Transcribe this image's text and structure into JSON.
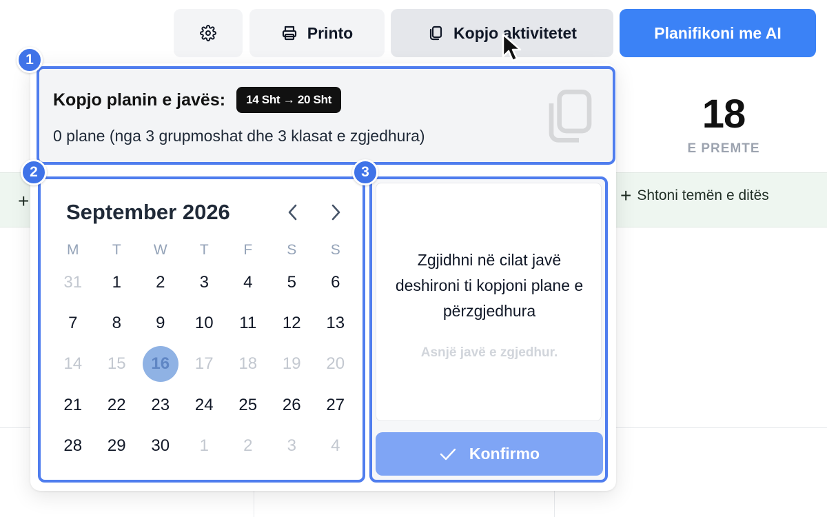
{
  "toolbar": {
    "settings_icon": "gear-icon",
    "print_label": "Printo",
    "print_icon": "printer-icon",
    "copy_label": "Kopjo aktivitetet",
    "copy_icon": "copy-icon",
    "ai_label": "Planifikoni me AI"
  },
  "calendar_bg": {
    "day_number": "18",
    "day_name": "E PREMTE",
    "add_theme_label": "Shtoni temën e ditës"
  },
  "badges": [
    "1",
    "2",
    "3"
  ],
  "copy_panel": {
    "title": "Kopjo planin e javës:",
    "week_range": "14 Sht → 20 Sht",
    "summary": "0 plane (nga 3 grupmoshat dhe 3 klasat e zgjedhura)"
  },
  "date_picker": {
    "month_label": "September 2026",
    "weekdays": [
      "M",
      "T",
      "W",
      "T",
      "F",
      "S",
      "S"
    ],
    "weeks": [
      [
        {
          "d": "31",
          "m": true
        },
        {
          "d": "1"
        },
        {
          "d": "2"
        },
        {
          "d": "3"
        },
        {
          "d": "4"
        },
        {
          "d": "5"
        },
        {
          "d": "6"
        }
      ],
      [
        {
          "d": "7"
        },
        {
          "d": "8"
        },
        {
          "d": "9"
        },
        {
          "d": "10"
        },
        {
          "d": "11"
        },
        {
          "d": "12"
        },
        {
          "d": "13"
        }
      ],
      [
        {
          "d": "14",
          "m": true
        },
        {
          "d": "15",
          "m": true
        },
        {
          "d": "16",
          "m": true,
          "s": true
        },
        {
          "d": "17",
          "m": true
        },
        {
          "d": "18",
          "m": true
        },
        {
          "d": "19",
          "m": true
        },
        {
          "d": "20",
          "m": true
        }
      ],
      [
        {
          "d": "21"
        },
        {
          "d": "22"
        },
        {
          "d": "23"
        },
        {
          "d": "24"
        },
        {
          "d": "25"
        },
        {
          "d": "26"
        },
        {
          "d": "27"
        }
      ],
      [
        {
          "d": "28"
        },
        {
          "d": "29"
        },
        {
          "d": "30"
        },
        {
          "d": "1",
          "m": true
        },
        {
          "d": "2",
          "m": true
        },
        {
          "d": "3",
          "m": true
        },
        {
          "d": "4",
          "m": true
        }
      ]
    ]
  },
  "weeks_panel": {
    "instructions": "Zgjidhni në cilat javë deshironi ti kopjoni plane e përzgjedhura",
    "empty_state": "Asnjë javë e zgjedhur.",
    "confirm_label": "Konfirmo"
  },
  "colors": {
    "accent": "#3b82f6",
    "highlight_border": "#4f7dee",
    "confirm_disabled": "#7fa5f5",
    "selected_day": "#8fb2e4"
  }
}
